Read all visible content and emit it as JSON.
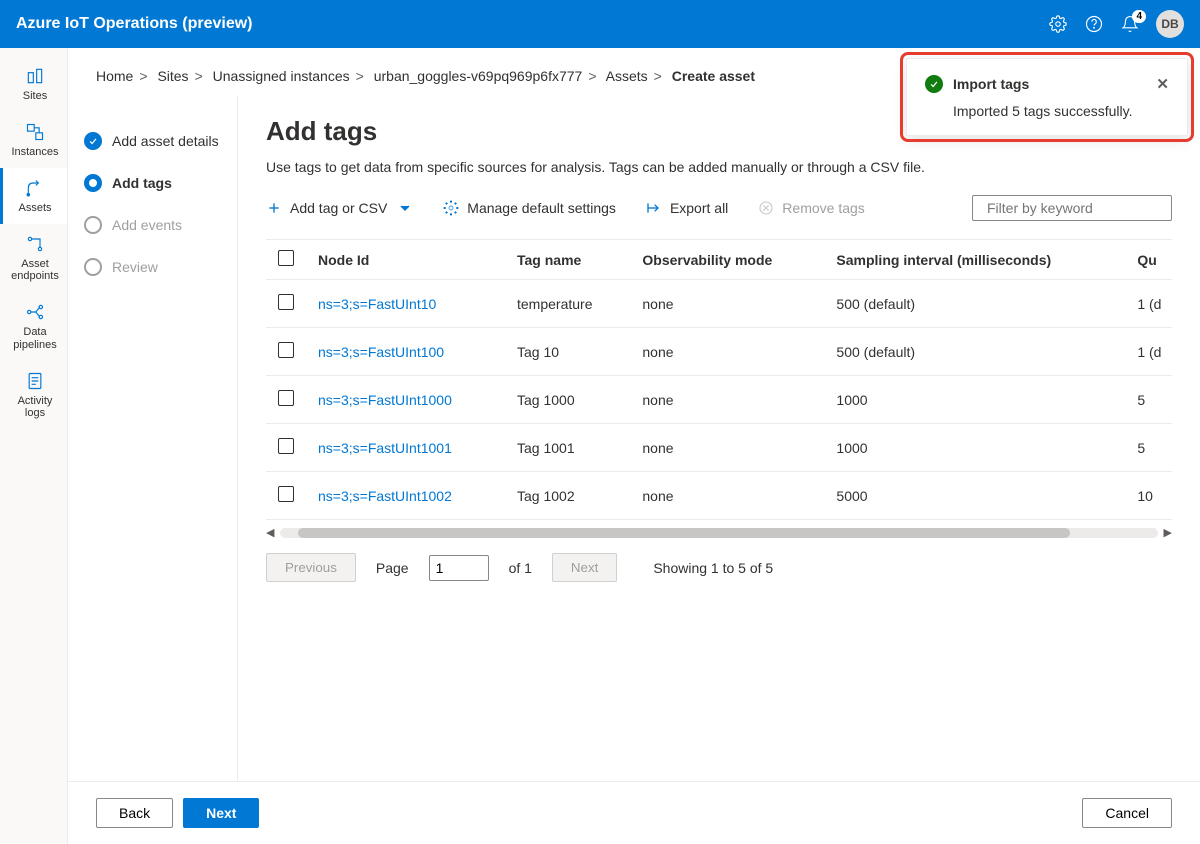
{
  "header": {
    "title": "Azure IoT Operations (preview)",
    "notification_count": "4",
    "user_initials": "DB"
  },
  "nav": {
    "items": [
      {
        "label": "Sites"
      },
      {
        "label": "Instances"
      },
      {
        "label": "Assets"
      },
      {
        "label": "Asset endpoints"
      },
      {
        "label": "Data pipelines"
      },
      {
        "label": "Activity logs"
      }
    ]
  },
  "breadcrumb": {
    "items": [
      "Home",
      "Sites",
      "Unassigned instances",
      "urban_goggles-v69pq969p6fx777",
      "Assets",
      "Create asset"
    ]
  },
  "steps": [
    {
      "label": "Add asset details",
      "state": "completed"
    },
    {
      "label": "Add tags",
      "state": "active"
    },
    {
      "label": "Add events",
      "state": "pending"
    },
    {
      "label": "Review",
      "state": "pending"
    }
  ],
  "main": {
    "title": "Add tags",
    "desc": "Use tags to get data from specific sources for analysis. Tags can be added manually or through a CSV file.",
    "toolbar": {
      "add": "Add tag or CSV",
      "manage": "Manage default settings",
      "export": "Export all",
      "remove": "Remove tags",
      "filter_placeholder": "Filter by keyword"
    },
    "columns": [
      "Node Id",
      "Tag name",
      "Observability mode",
      "Sampling interval (milliseconds)",
      "Qu"
    ],
    "rows": [
      {
        "nodeId": "ns=3;s=FastUInt10",
        "tagName": "temperature",
        "obs": "none",
        "sampling": "500 (default)",
        "queue": "1 (d"
      },
      {
        "nodeId": "ns=3;s=FastUInt100",
        "tagName": "Tag 10",
        "obs": "none",
        "sampling": "500 (default)",
        "queue": "1 (d"
      },
      {
        "nodeId": "ns=3;s=FastUInt1000",
        "tagName": "Tag 1000",
        "obs": "none",
        "sampling": "1000",
        "queue": "5"
      },
      {
        "nodeId": "ns=3;s=FastUInt1001",
        "tagName": "Tag 1001",
        "obs": "none",
        "sampling": "1000",
        "queue": "5"
      },
      {
        "nodeId": "ns=3;s=FastUInt1002",
        "tagName": "Tag 1002",
        "obs": "none",
        "sampling": "5000",
        "queue": "10"
      }
    ],
    "pager": {
      "prev": "Previous",
      "next": "Next",
      "page_label": "Page",
      "page_value": "1",
      "of_label": "of 1",
      "showing": "Showing 1 to 5 of 5"
    }
  },
  "footer": {
    "back": "Back",
    "next": "Next",
    "cancel": "Cancel"
  },
  "toast": {
    "title": "Import tags",
    "body": "Imported 5 tags successfully."
  }
}
